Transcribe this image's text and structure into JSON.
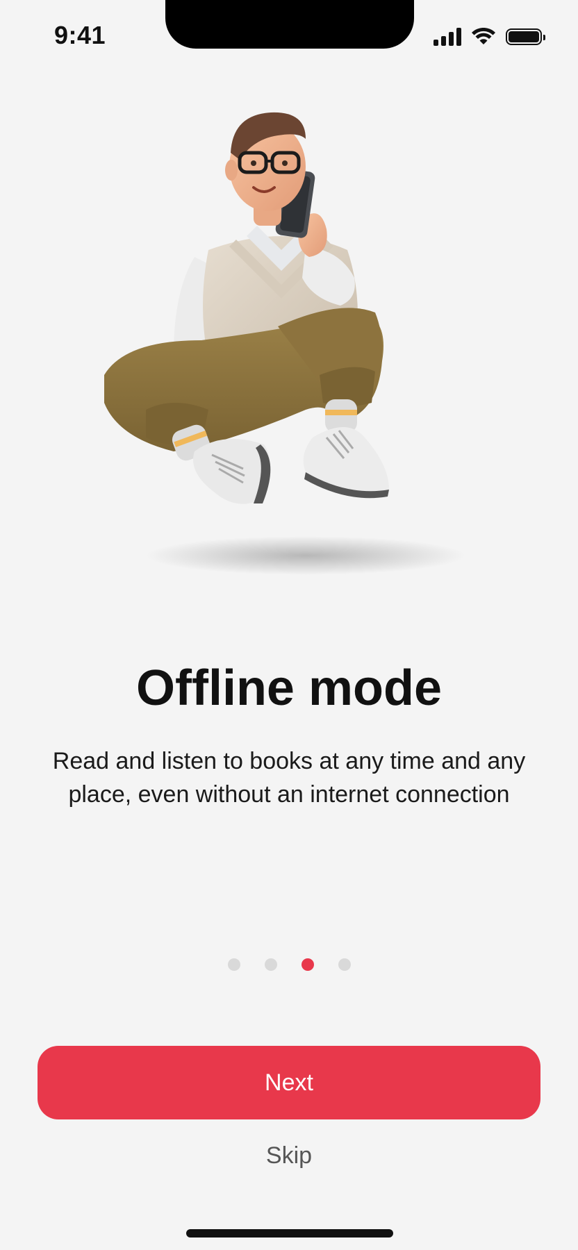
{
  "status_bar": {
    "time": "9:41",
    "icons": [
      "signal-icon",
      "wifi-icon",
      "battery-icon"
    ]
  },
  "illustration": {
    "name": "3d-character-with-phone-illustration"
  },
  "onboarding": {
    "title": "Offline mode",
    "description": "Read and listen to books at any time and any place, even without an internet connection",
    "page_index": 2,
    "page_count": 4
  },
  "actions": {
    "next_label": "Next",
    "skip_label": "Skip"
  },
  "colors": {
    "accent": "#e8384b",
    "background": "#f4f4f4",
    "dot_inactive": "#d9d9d9"
  }
}
